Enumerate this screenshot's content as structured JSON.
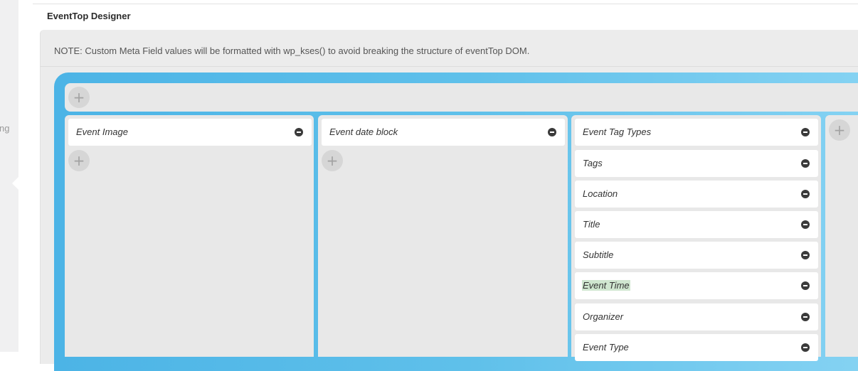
{
  "sidebar": {
    "partial_text": "ng"
  },
  "section": {
    "title": "EventTop Designer"
  },
  "note": {
    "text": "NOTE: Custom Meta Field values will be formatted with wp_kses() to avoid breaking the structure of eventTop DOM."
  },
  "icons": {
    "add": "+"
  },
  "columns": [
    {
      "fields": [
        {
          "label": "Event Image"
        }
      ]
    },
    {
      "fields": [
        {
          "label": "Event date block"
        }
      ]
    },
    {
      "fields": [
        {
          "label": "Event Tag Types"
        },
        {
          "label": "Tags"
        },
        {
          "label": "Location"
        },
        {
          "label": "Title"
        },
        {
          "label": "Subtitle"
        },
        {
          "label": "Event Time",
          "highlighted": true
        },
        {
          "label": "Organizer"
        },
        {
          "label": "Event Type"
        }
      ]
    },
    {
      "fields": []
    }
  ],
  "colors": {
    "frame_gradient_start": "#4cb4e6",
    "frame_gradient_end": "#86d3f3",
    "highlight": "#cfe6cf"
  }
}
